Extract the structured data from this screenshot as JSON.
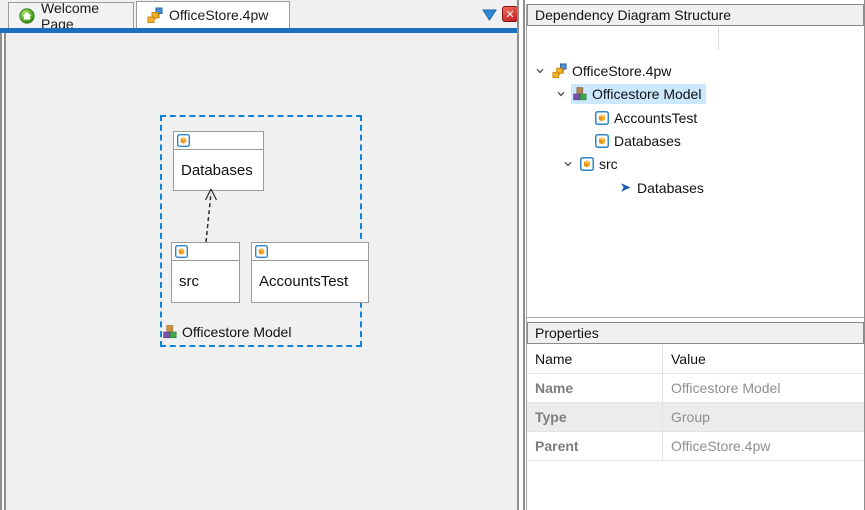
{
  "tabs": {
    "items": [
      {
        "label": "Welcome Page",
        "icon": "welcome-icon",
        "active": false
      },
      {
        "label": "OfficeStore.4pw",
        "icon": "project-icon",
        "active": true
      }
    ],
    "controls": {
      "tab_list_tooltip_glyph": "triangle-down",
      "close_glyph": "x"
    }
  },
  "canvas": {
    "group": {
      "label": "Officestore Model",
      "icon": "model-icon",
      "nodes": [
        {
          "label": "Databases",
          "icon": "package-icon"
        },
        {
          "label": "src",
          "icon": "package-icon"
        },
        {
          "label": "AccountsTest",
          "icon": "package-icon"
        }
      ],
      "edge": {
        "from": "src",
        "to": "Databases",
        "style": "dashed-open-arrow"
      }
    }
  },
  "structure_panel": {
    "title": "Dependency Diagram Structure",
    "tree": [
      {
        "label": "OfficeStore.4pw",
        "icon": "project-icon",
        "level": 0,
        "expanded": true,
        "selected": false
      },
      {
        "label": "Officestore Model",
        "icon": "model-icon",
        "level": 1,
        "expanded": true,
        "selected": true
      },
      {
        "label": "AccountsTest",
        "icon": "package-icon",
        "level": 2,
        "expanded": false,
        "selected": false
      },
      {
        "label": "Databases",
        "icon": "package-icon",
        "level": 2,
        "expanded": false,
        "selected": false
      },
      {
        "label": "src",
        "icon": "package-icon",
        "level": 2,
        "expanded": true,
        "selected": false
      },
      {
        "label": "Databases",
        "icon": "link-icon",
        "level": 3,
        "expanded": false,
        "selected": false
      }
    ]
  },
  "properties_panel": {
    "title": "Properties",
    "columns": [
      "Name",
      "Value"
    ],
    "rows": [
      {
        "name": "Name",
        "value": "Officestore Model"
      },
      {
        "name": "Type",
        "value": "Group"
      },
      {
        "name": "Parent",
        "value": "OfficeStore.4pw"
      }
    ]
  },
  "colors": {
    "accent_blue_bar": "#1b6fbf",
    "group_border": "#0e83d8",
    "tree_selection": "#cbe8ff",
    "canvas_bg": "#f0f0f0",
    "close_red": "#c21e1e",
    "stripe_gray": "#ececec"
  }
}
